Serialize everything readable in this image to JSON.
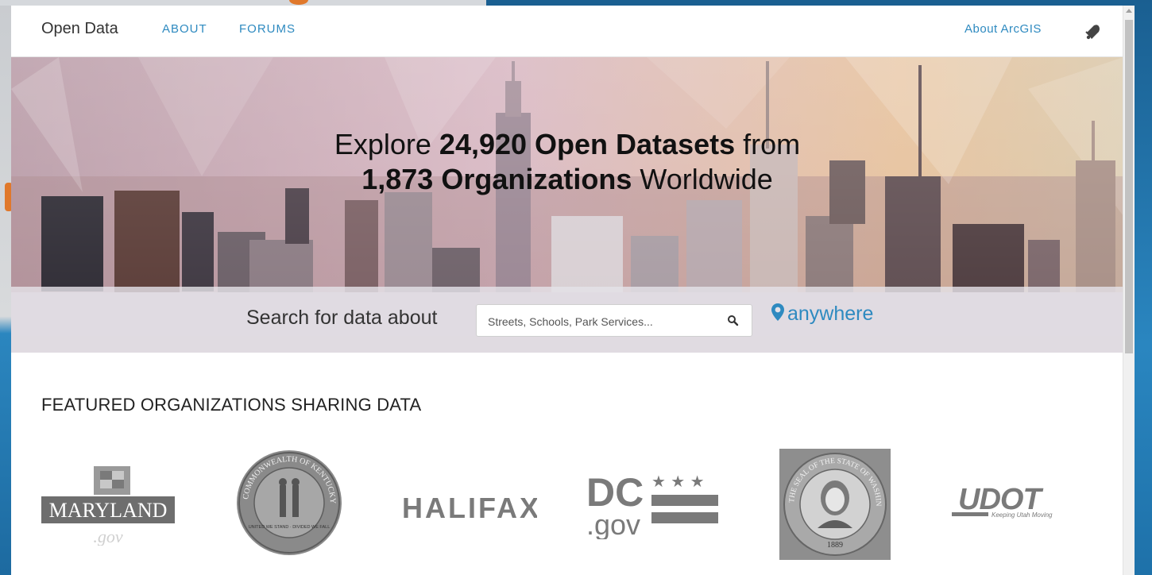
{
  "nav": {
    "brand": "Open Data",
    "links": [
      "ABOUT",
      "FORUMS"
    ],
    "about_arcgis": "About ArcGIS",
    "notification_icon": "bell-icon"
  },
  "hero": {
    "headline_line1_prefix": "Explore ",
    "headline_line1_bold": "24,920 Open Datasets",
    "headline_line1_suffix": " from",
    "headline_line2_bold": "1,873 Organizations",
    "headline_line2_suffix": " Worldwide"
  },
  "search": {
    "label": "Search for data about",
    "placeholder": "Streets, Schools, Park Services...",
    "search_icon": "search-icon",
    "location_icon": "map-marker-icon",
    "location_label": "anywhere"
  },
  "featured": {
    "heading": "FEATURED ORGANIZATIONS SHARING DATA",
    "organizations": [
      {
        "name": "Maryland",
        "logo_text": "MARYLAND",
        "logo_subtext": ".gov"
      },
      {
        "name": "Commonwealth of Kentucky",
        "logo_text": "COMMONWEALTH OF KENTUCKY",
        "logo_subtext": "UNITED WE STAND · DIVIDED WE FALL"
      },
      {
        "name": "Halifax",
        "logo_text": "HALIFAX",
        "logo_subtext": ""
      },
      {
        "name": "DC.gov",
        "logo_text": "DC",
        "logo_subtext": ".gov"
      },
      {
        "name": "State of Washington",
        "logo_text": "THE SEAL OF THE STATE OF WASHINGTON",
        "logo_subtext": "1889"
      },
      {
        "name": "UDOT",
        "logo_text": "UDOT",
        "logo_subtext": "Keeping Utah Moving"
      }
    ]
  },
  "colors": {
    "link": "#2e8ac0",
    "backdrop": "#2a7fb4",
    "logo_gray": "#7a7a7a"
  }
}
